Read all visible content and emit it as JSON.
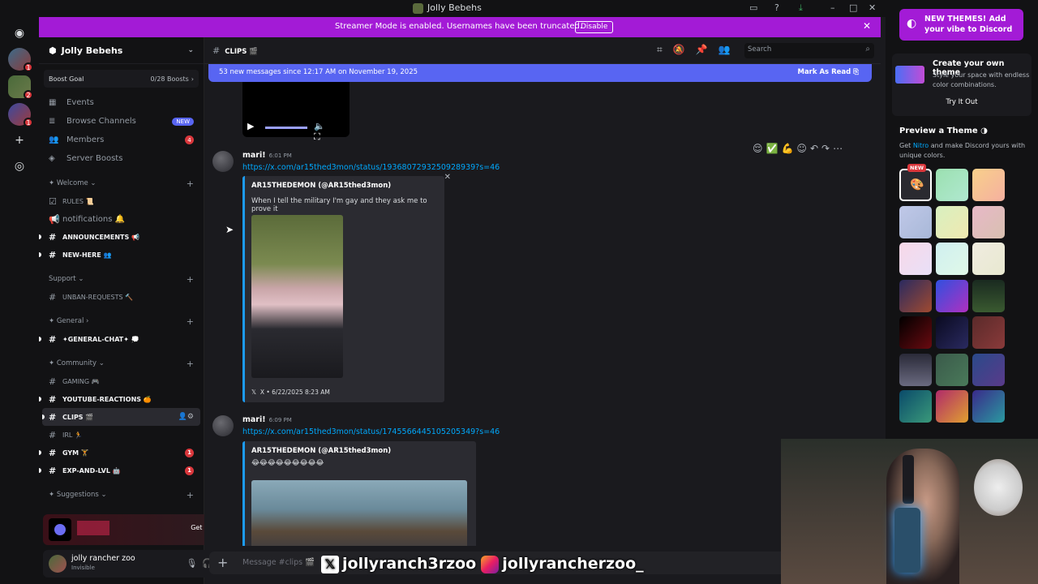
{
  "window": {
    "title": "Jolly Bebehs"
  },
  "banner": {
    "message": "Streamer Mode is enabled. Usernames have been truncated.",
    "button": "Disable",
    "close": "✕"
  },
  "server": {
    "name": "Jolly Bebehs",
    "boost_label": "Boost Goal",
    "boost_count": "0/28 Boosts",
    "nav": [
      {
        "label": "Events",
        "icon": "calendar-icon"
      },
      {
        "label": "Browse Channels",
        "icon": "browse-icon",
        "pill": "NEW"
      },
      {
        "label": "Members",
        "icon": "members-icon",
        "count": "4"
      },
      {
        "label": "Server Boosts",
        "icon": "boost-icon"
      }
    ]
  },
  "channels": {
    "cat_welcome": "✦ Welcome",
    "rules": "RULES 📜",
    "notifications": "notifications 🔔",
    "announcements": "ANNOUNCEMENTS 📢",
    "new_here": "NEW-HERE 👥",
    "cat_support": "Support",
    "unban": "UNBAN-REQUESTS 🔨",
    "cat_general": "✦ General",
    "general_chat": "✦GENERAL-CHAT✦ 💭",
    "cat_community": "✦ Community",
    "gaming": "GAMING 🎮",
    "youtube": "YOUTUBE-REACTIONS 🍊",
    "clips": "CLIPS 🎬",
    "irl": "IRL 🏃",
    "gym": "GYM 🏋",
    "gym_count": "1",
    "exp": "EXP-AND-LVL 🤖",
    "exp_count": "1",
    "cat_suggestions": "✦ Suggestions"
  },
  "promo": {
    "button": "Get Reward!"
  },
  "user": {
    "name": "jolly rancher zoo",
    "status": "Invisible"
  },
  "channel_header": {
    "name": "CLIPS 🎬",
    "search_placeholder": "Search"
  },
  "new_messages": {
    "text": "53 new messages since 12:17 AM on November 19, 2025",
    "action": "Mark As Read"
  },
  "messages": [
    {
      "author": "mari!",
      "time": "6:01 PM",
      "link": "https://x.com/ar15thed3mon/status/1936807293250928939?s=46",
      "embed_author": "AR15THEDEMON (@AR15thed3mon)",
      "embed_text": "When I tell the military I'm gay and they ask me to prove it",
      "embed_footer": "X • 6/22/2025 8:23 AM"
    },
    {
      "author": "mari!",
      "time": "6:09 PM",
      "link": "https://x.com/ar15thed3mon/status/1745566445105205349?s=46",
      "embed_author": "AR15THEDEMON (@AR15thed3mon)",
      "embed_text": "😂😂😂😂😂😂😂😂😂"
    }
  ],
  "composer": {
    "placeholder": "Message #clips 🎬"
  },
  "overlay": {
    "x_handle": "jollyranch3rzoo",
    "ig_handle": "jollyrancherzoo_"
  },
  "right_panel": {
    "new_themes": "NEW THEMES! Add your vibe to Discord",
    "create_title": "Create your own theme",
    "create_desc": "Style your space with endless color combinations.",
    "try_button": "Try It Out",
    "preview_title": "Preview a Theme",
    "preview_desc_pre": "Get ",
    "preview_nitro": "Nitro",
    "preview_desc_post": " and make Discord yours with unique colors.",
    "new_badge": "NEW"
  },
  "colors": {
    "accent": "#5865f2",
    "streamer_banner": "#a31bd6",
    "link": "#00a8fc"
  }
}
